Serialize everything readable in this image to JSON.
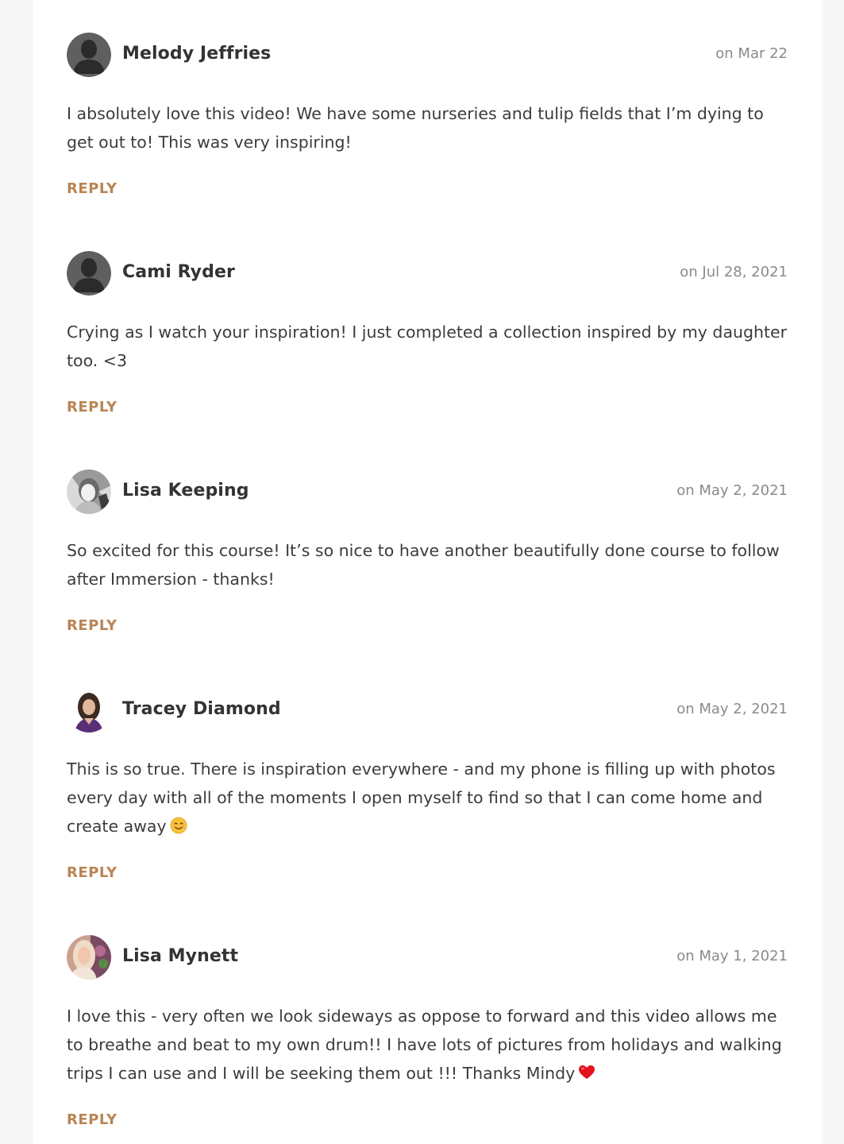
{
  "comments": [
    {
      "author": "Melody Jeffries",
      "date": "on Mar 22",
      "text": "I absolutely love this video! We have some nurseries and tulip fields that I’m dying to get out to! This was very inspiring!",
      "reply_label": "REPLY",
      "avatar": "default-silhouette"
    },
    {
      "author": "Cami Ryder",
      "date": "on Jul 28, 2021",
      "text": "Crying as I watch your inspiration! I just completed a collection inspired by my daughter too. <3",
      "reply_label": "REPLY",
      "avatar": "default-silhouette"
    },
    {
      "author": "Lisa Keeping",
      "date": "on May 2, 2021",
      "text": "So excited for this course! It’s so nice to have another beautifully done course to follow after Immersion - thanks!",
      "reply_label": "REPLY",
      "avatar": "photo"
    },
    {
      "author": "Tracey Diamond",
      "date": "on May 2, 2021",
      "text": "This is so true. There is inspiration everywhere - and my phone is filling up with photos every day with all of the moments I open myself to find so that I can come home and create away",
      "emoji": "smiling-face-icon",
      "reply_label": "REPLY",
      "avatar": "photo"
    },
    {
      "author": "Lisa Mynett",
      "date": "on May 1, 2021",
      "text": "I love this - very often we look sideways as oppose to forward and this video allows me to breathe and beat to my own drum!! I have lots of pictures from holidays and walking trips I can use and I will be seeking them out !!! Thanks Mindy",
      "emoji": "red-heart-icon",
      "reply_label": "REPLY",
      "avatar": "photo"
    }
  ],
  "colors": {
    "reply": "#b98455",
    "date": "#8a8a8a",
    "author": "#333333",
    "page_bg": "#f7f7f7"
  }
}
